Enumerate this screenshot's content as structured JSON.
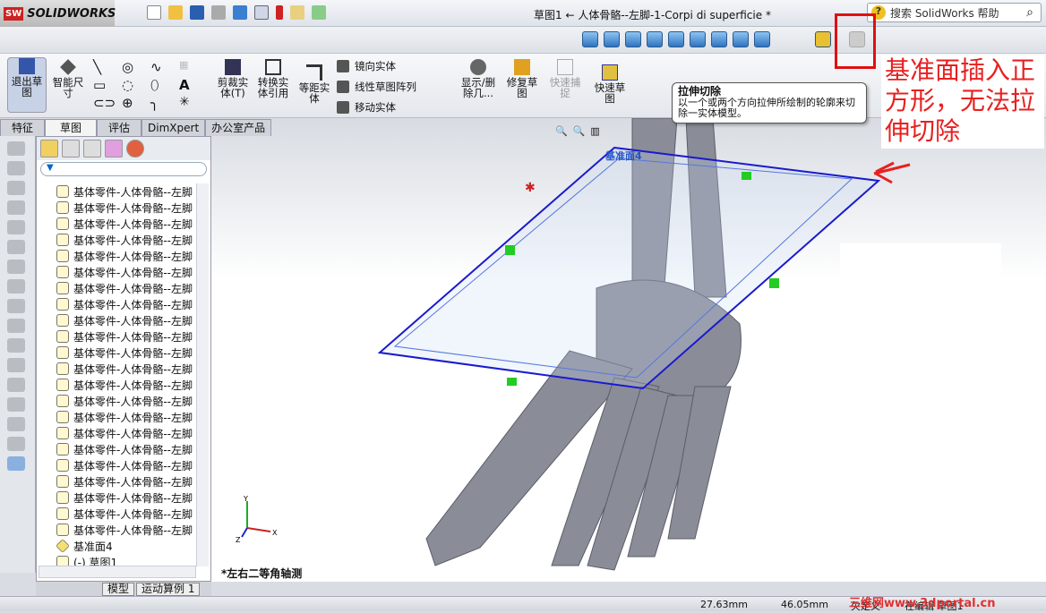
{
  "app": {
    "logo": "SOLIDWORKS",
    "title": "草图1 ← 人体骨骼--左脚-1-Corpi di superficie *"
  },
  "search": {
    "placeholder": "搜索 SolidWorks 帮助"
  },
  "ribbon": {
    "exit_sketch": "退出草图",
    "smart_dim": "智能尺寸",
    "trim": "剪裁实体(T)",
    "convert": "转换实体引用",
    "offset": "等距实体",
    "mirror": "镜向实体",
    "linear_pattern": "线性草图阵列",
    "move": "移动实体",
    "display_delete": "显示/删除几...",
    "repair": "修复草图",
    "quick_snap": "快速捕捉",
    "rapid_sketch": "快速草图"
  },
  "tabs": [
    "特征",
    "草图",
    "评估",
    "DimXpert",
    "办公室产品"
  ],
  "active_tab": "草图",
  "tooltip": {
    "title": "拉伸切除",
    "body": "以一个或两个方向拉伸所绘制的轮廓来切除一实体模型。"
  },
  "annotation": "基准面插入正方形，无法拉伸切除",
  "tree": {
    "items": [
      "基体零件-人体骨骼--左脚",
      "基体零件-人体骨骼--左脚",
      "基体零件-人体骨骼--左脚",
      "基体零件-人体骨骼--左脚",
      "基体零件-人体骨骼--左脚",
      "基体零件-人体骨骼--左脚",
      "基体零件-人体骨骼--左脚",
      "基体零件-人体骨骼--左脚",
      "基体零件-人体骨骼--左脚",
      "基体零件-人体骨骼--左脚",
      "基体零件-人体骨骼--左脚",
      "基体零件-人体骨骼--左脚",
      "基体零件-人体骨骼--左脚",
      "基体零件-人体骨骼--左脚",
      "基体零件-人体骨骼--左脚",
      "基体零件-人体骨骼--左脚",
      "基体零件-人体骨骼--左脚",
      "基体零件-人体骨骼--左脚",
      "基体零件-人体骨骼--左脚",
      "基体零件-人体骨骼--左脚",
      "基体零件-人体骨骼--左脚",
      "基体零件-人体骨骼--左脚"
    ],
    "plane": "基准面4",
    "sketch": "(-) 草图1"
  },
  "bottom_tabs": [
    "模型",
    "运动算例 1"
  ],
  "viewport": {
    "view_label": "*左右二等角轴测",
    "plane_label": "基准面4",
    "axes": [
      "X",
      "Y",
      "Z"
    ]
  },
  "status": {
    "x": "27.63mm",
    "y": "46.05mm",
    "state": "欠定义",
    "editing": "在编辑 草图1",
    "watermark": "三维网www.3dportal.cn"
  },
  "colors": {
    "sketch": "#1a1acc",
    "annotation": "#e82020",
    "bone": "#8a8d98"
  }
}
